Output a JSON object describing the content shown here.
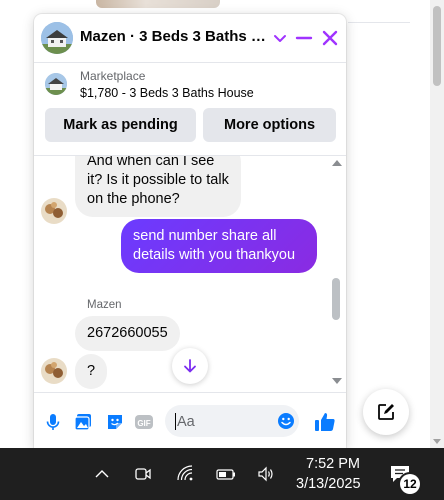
{
  "chat": {
    "title": "Mazen · 3 Beds 3 Baths Ho...",
    "listing": {
      "source": "Marketplace",
      "title": "$1,780 - 3 Beds 3 Baths House"
    },
    "buttons": {
      "pending": "Mark as pending",
      "more": "More options"
    },
    "messages": [
      {
        "direction": "incoming",
        "text": "And when can I see it? Is it possible to talk on the phone?"
      },
      {
        "direction": "outgoing",
        "text": "send number share all details with you thankyou"
      },
      {
        "direction": "incoming",
        "sender": "Mazen",
        "text": "2672660055"
      },
      {
        "direction": "incoming",
        "text": "?"
      }
    ],
    "composer": {
      "placeholder": "Aa"
    }
  },
  "taskbar": {
    "time": "7:52 PM",
    "date": "3/13/2025",
    "notification_count": "12"
  },
  "colors": {
    "accent": "#a033ff",
    "outgoing_bubble": "#7b2cf0",
    "messenger_blue": "#0a7cff",
    "taskbar": "#1f1f1f"
  },
  "icons": [
    "chevron-down-icon",
    "minimize-icon",
    "close-icon",
    "microphone-icon",
    "photo-icon",
    "sticker-icon",
    "gif-icon",
    "emoji-icon",
    "thumbs-up-icon",
    "arrow-down-icon",
    "new-message-icon",
    "chevron-up-icon",
    "meet-now-icon",
    "wifi-icon",
    "battery-icon",
    "volume-icon",
    "notification-icon"
  ]
}
